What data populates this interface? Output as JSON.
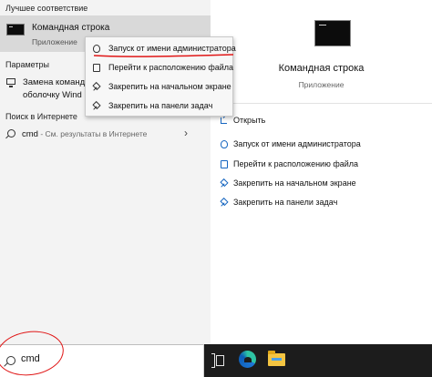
{
  "left_pane": {
    "best_match_header": "Лучшее соответствие",
    "best_match": {
      "title": "Командная строка",
      "subtitle": "Приложение",
      "icon": "command-prompt-icon"
    },
    "settings_header": "Параметры",
    "settings_item": {
      "line1": "Замена команд",
      "line2": "оболочку Wind",
      "icon": "monitor-icon"
    },
    "web_header": "Поиск в Интернете",
    "web_item": {
      "query": "cmd",
      "suffix": " - См. результаты в Интернете",
      "icon": "search-icon"
    }
  },
  "context_menu": {
    "items": [
      {
        "label": "Запуск от имени администратора",
        "icon": "shield-icon"
      },
      {
        "label": "Перейти к расположению файла",
        "icon": "folder-icon"
      },
      {
        "label": "Закрепить на начальном экране",
        "icon": "pin-icon"
      },
      {
        "label": "Закрепить на панели задач",
        "icon": "pin-icon"
      }
    ]
  },
  "detail": {
    "title": "Командная строка",
    "subtitle": "Приложение",
    "icon": "command-prompt-icon",
    "actions": [
      {
        "label": "Открыть",
        "icon": "open-icon"
      },
      {
        "label": "Запуск от имени администратора",
        "icon": "shield-icon"
      },
      {
        "label": "Перейти к расположению файла",
        "icon": "folder-icon"
      },
      {
        "label": "Закрепить на начальном экране",
        "icon": "pin-icon"
      },
      {
        "label": "Закрепить на панели задач",
        "icon": "pin-icon"
      }
    ]
  },
  "search": {
    "value": "cmd",
    "icon": "search-icon"
  },
  "taskbar": {
    "icons": [
      "task-view-icon",
      "edge-icon",
      "file-explorer-icon"
    ]
  },
  "colors": {
    "accent_blue": "#1565c0",
    "annotation_red": "#e01616",
    "selected_row": "#d9d9d9",
    "taskbar": "#1c1c1c"
  }
}
